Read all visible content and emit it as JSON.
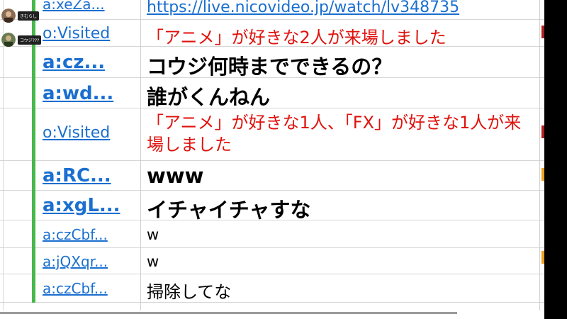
{
  "viewers": [
    {
      "name": "きむらし"
    },
    {
      "name": "コウジ???"
    }
  ],
  "comments": [
    {
      "user": "a:xeZa...",
      "text": "https://live.nicovideo.jp/watch/lv348735",
      "color": "#1a6fd0",
      "link": true
    },
    {
      "user": "o:Visited",
      "text": "「アニメ」が好きな2人が来場しました",
      "color": "#e0120d"
    },
    {
      "user": "a:cz...",
      "text": "コウジ何時までできるの？",
      "color": "#000000"
    },
    {
      "user": "a:wd...",
      "text": "誰がくんねん",
      "color": "#000000"
    },
    {
      "user": "o:Visited",
      "text": "「アニメ」が好きな1人、「FX」が好きな1人が来場しました",
      "color": "#e0120d"
    },
    {
      "user": "a:RC...",
      "text": "www",
      "color": "#000000"
    },
    {
      "user": "a:xgL...",
      "text": "イチャイチャすな",
      "color": "#000000"
    },
    {
      "user": "a:czCbf...",
      "text": "w",
      "color": "#000000"
    },
    {
      "user": "a:jQXqr...",
      "text": "w",
      "color": "#000000"
    },
    {
      "user": "a:czCbf...",
      "text": "掃除してな",
      "color": "#000000"
    }
  ],
  "colors": {
    "link": "#1a6fd0",
    "system": "#e0120d",
    "owner_bar": "#48b84c",
    "marker_red": "#b02020",
    "marker_orange": "#f0a020"
  }
}
